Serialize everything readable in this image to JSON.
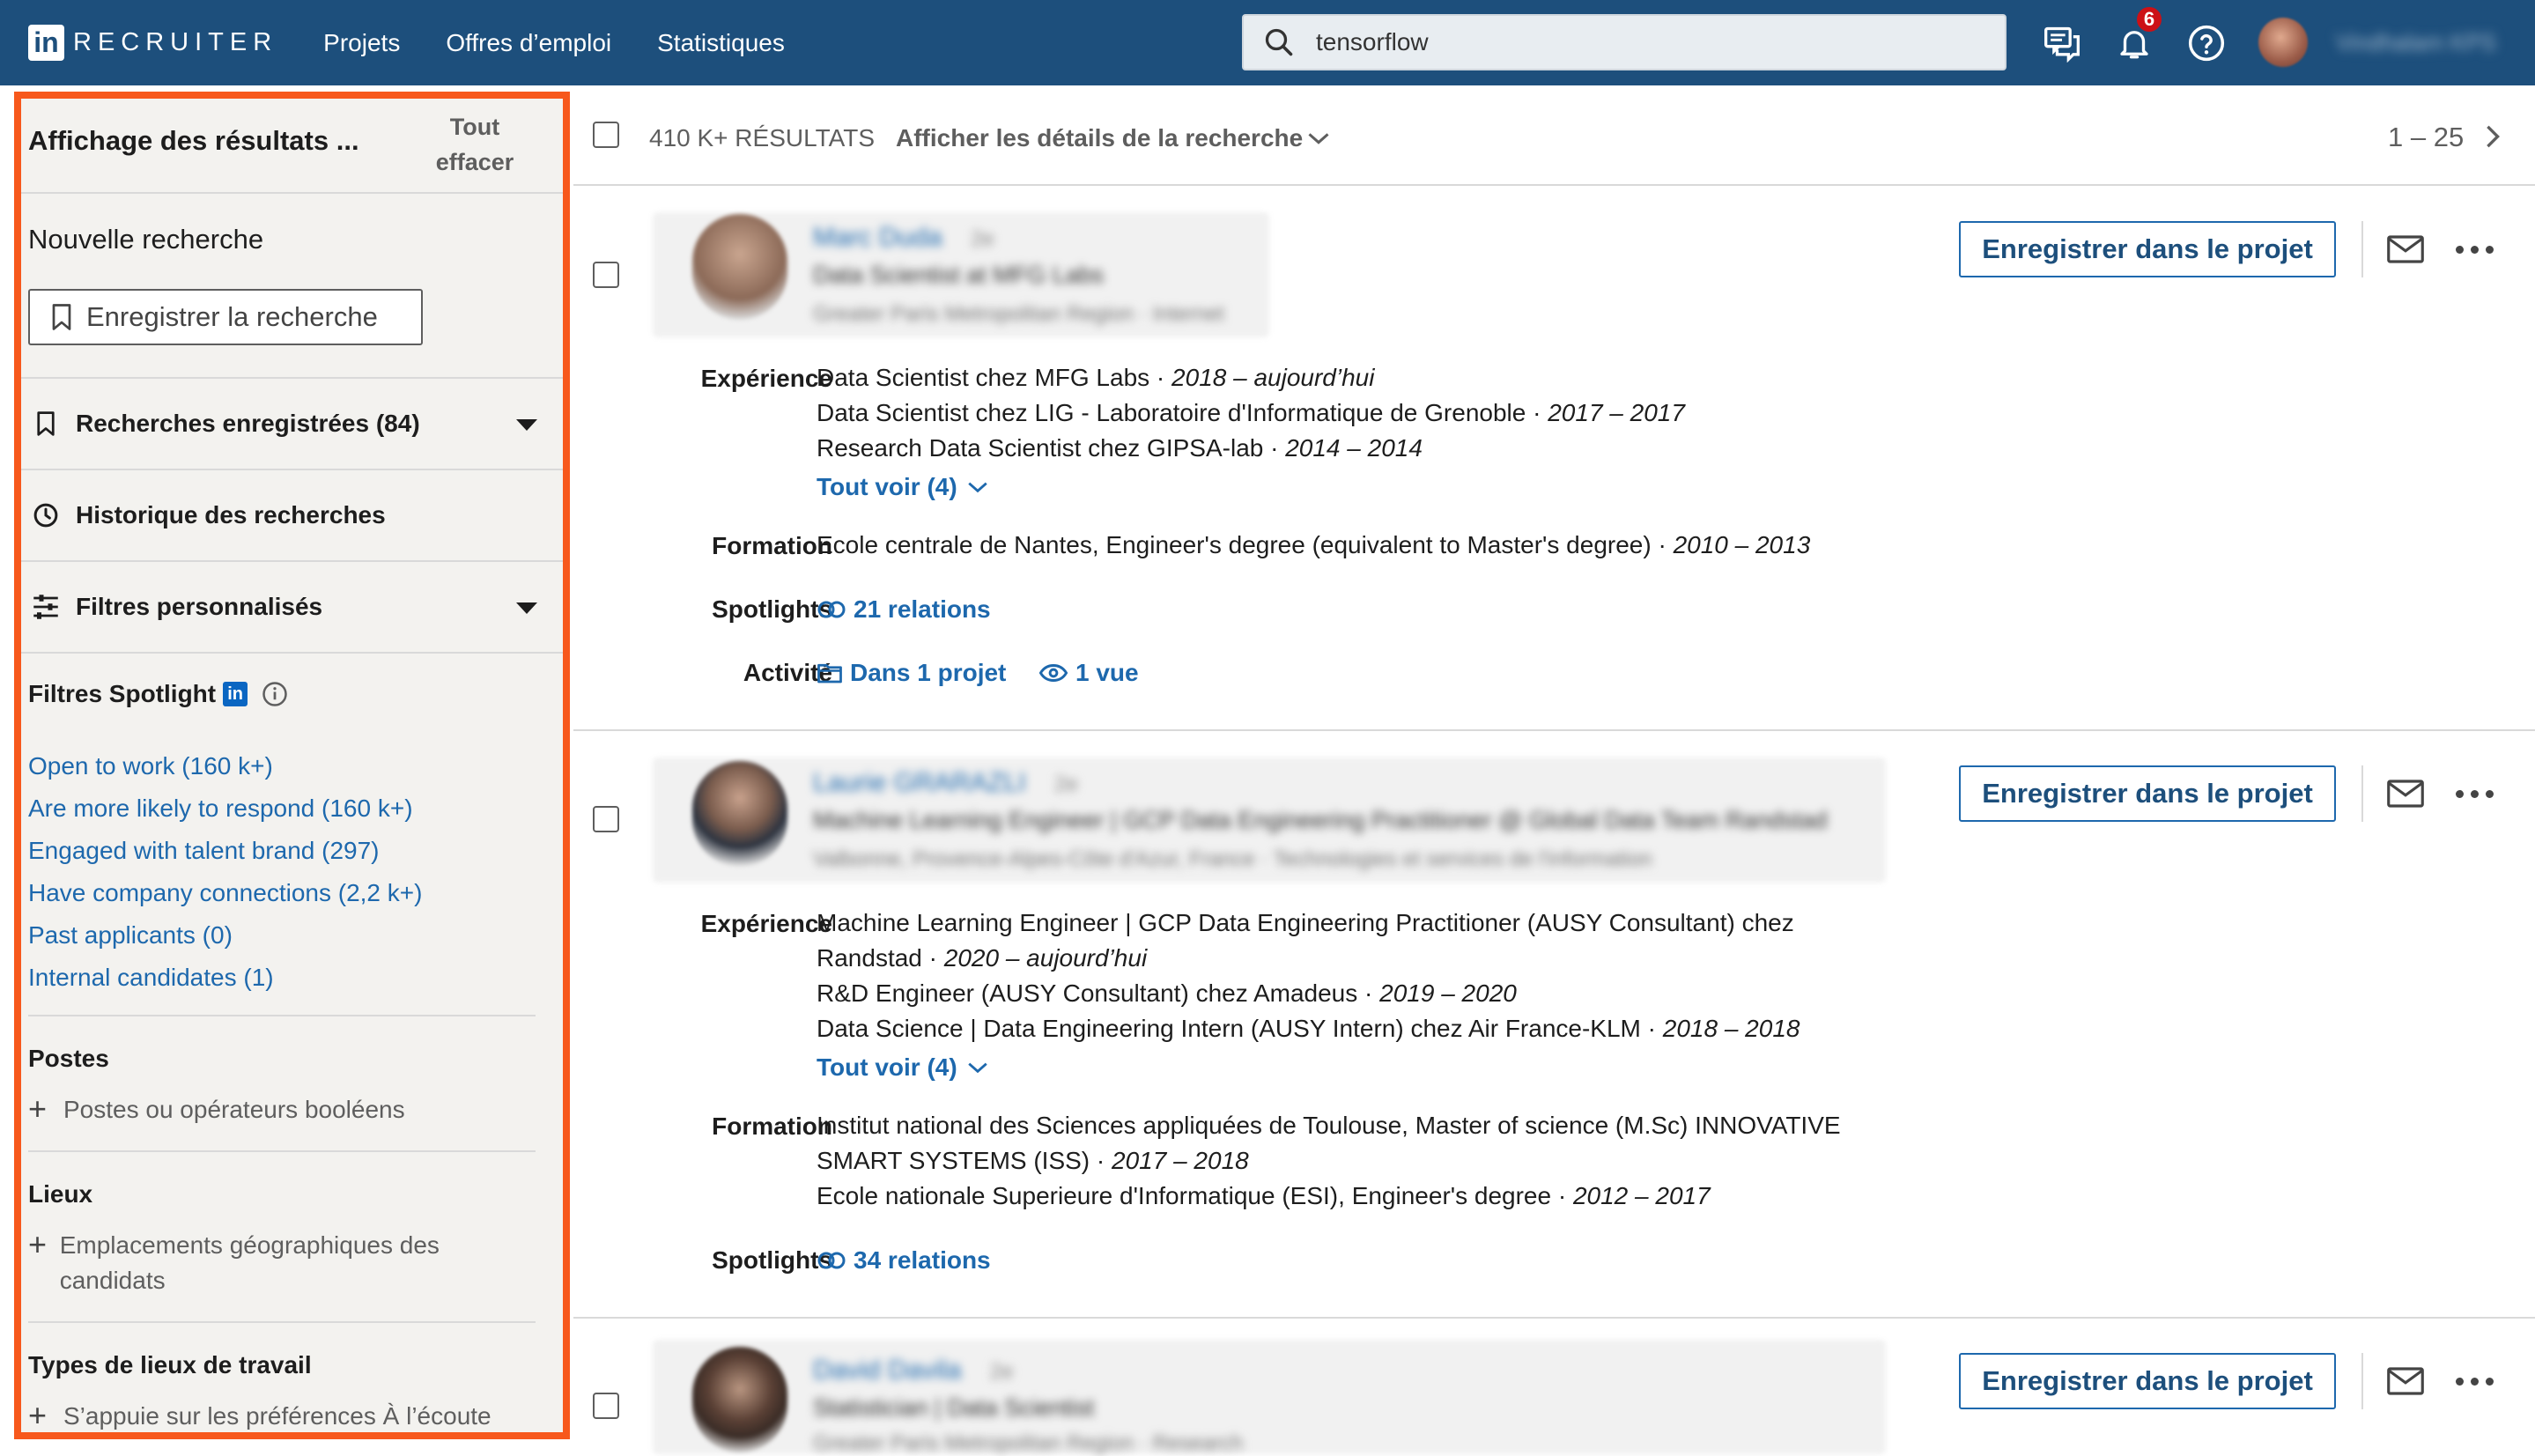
{
  "nav": {
    "brand": "RECRUITER",
    "logo_letters": "in",
    "items": [
      "Projets",
      "Offres d’emploi",
      "Statistiques"
    ],
    "search_value": "tensorflow",
    "notif_count": "6",
    "user_name": "Vindhalam KPS"
  },
  "sidebar": {
    "title": "Affichage des résultats ...",
    "clear_line1": "Tout",
    "clear_line2": "effacer",
    "new_search": "Nouvelle recherche",
    "save_search": "Enregistrer la recherche",
    "saved_searches": "Recherches enregistrées (84)",
    "history": "Historique des recherches",
    "custom_filters": "Filtres personnalisés",
    "spotlight_title": "Filtres Spotlight",
    "spotlight_items": [
      "Open to work (160 k+)",
      "Are more likely to respond (160 k+)",
      "Engaged with talent brand (297)",
      "Have company connections (2,2 k+)",
      "Past applicants (0)",
      "Internal candidates (1)"
    ],
    "postes_title": "Postes",
    "postes_add": "Postes ou opérateurs booléens",
    "lieux_title": "Lieux",
    "lieux_add": "Emplacements géographiques des candidats",
    "worktype_title": "Types de lieux de travail",
    "worktype_add": "S’appuie sur les préférences À l’écoute"
  },
  "results": {
    "count": "410 K+ RÉSULTATS",
    "details": "Afficher les détails de la recherche",
    "pager": "1 – 25"
  },
  "labels": {
    "experience": "Expérience",
    "formation": "Formation",
    "spotlights": "Spotlights",
    "activite": "Activité",
    "save_project": "Enregistrer dans le projet",
    "see_all": "Tout voir (4)"
  },
  "candidates": [
    {
      "name": "Marc Duda",
      "degree": "2e",
      "headline": "Data Scientist at MFG Labs",
      "location": "Greater Paris Metropolitan Region · Internet",
      "experience": [
        {
          "text": "Data Scientist chez MFG Labs · ",
          "dates": "2018 – aujourd’hui"
        },
        {
          "text": "Data Scientist chez LIG - Laboratoire d'Informatique de Grenoble · ",
          "dates": "2017 – 2017"
        },
        {
          "text": "Research Data Scientist chez GIPSA-lab · ",
          "dates": "2014 – 2014"
        }
      ],
      "education": [
        {
          "text": "Ecole centrale de Nantes, Engineer's degree (equivalent to Master's degree) · ",
          "dates": "2010 – 2013"
        }
      ],
      "spotlights": "21 relations",
      "activity_project": "Dans 1 projet",
      "activity_views": "1 vue"
    },
    {
      "name": "Laurie GRARAZLI",
      "degree": "2e",
      "headline": "Machine Learning Engineer | GCP Data Engineering Practitioner @ Global Data Team Randstad",
      "location": "Valbonne, Provence-Alpes-Côte d'Azur, France · Technologies et services de l'information",
      "experience": [
        {
          "text": "Machine Learning Engineer | GCP Data Engineering Practitioner (AUSY Consultant) chez",
          "dates": ""
        },
        {
          "text": "Randstad · ",
          "dates": "2020 – aujourd’hui"
        },
        {
          "text": "R&D Engineer (AUSY Consultant) chez Amadeus · ",
          "dates": "2019 – 2020"
        },
        {
          "text": "Data Science | Data Engineering Intern (AUSY Intern) chez Air France-KLM · ",
          "dates": "2018 – 2018"
        }
      ],
      "education": [
        {
          "text": "Institut national des Sciences appliquées de Toulouse, Master of science (M.Sc) INNOVATIVE",
          "dates": ""
        },
        {
          "text": "SMART SYSTEMS (ISS) · ",
          "dates": "2017 – 2018"
        },
        {
          "text": "Ecole nationale Superieure d'Informatique (ESI), Engineer's degree · ",
          "dates": "2012 – 2017"
        }
      ],
      "spotlights": "34 relations"
    },
    {
      "name": "David Davila",
      "degree": "2e",
      "headline": "Statistician | Data Scientist",
      "location": "Greater Paris Metropolitan Region · Research"
    }
  ]
}
